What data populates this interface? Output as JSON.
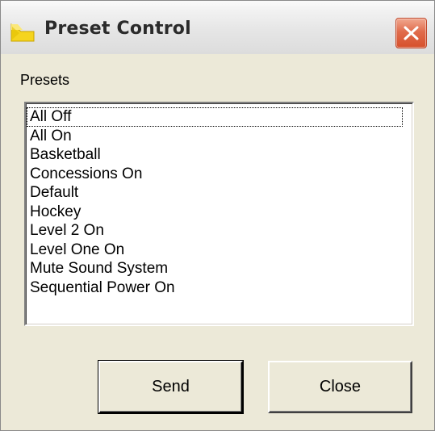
{
  "window": {
    "title": "Preset Control",
    "icon": "folder-arrow-icon",
    "close_icon": "close-x-icon"
  },
  "presets": {
    "label": "Presets",
    "focused_index": 0,
    "items": [
      "All Off",
      "All On",
      "Basketball",
      "Concessions On",
      "Default",
      "Hockey",
      "Level 2 On",
      "Level One On",
      "Mute Sound System",
      "Sequential Power On"
    ]
  },
  "buttons": {
    "send_label": "Send",
    "close_label": "Close"
  },
  "colors": {
    "dialog_face": "#ece9d8",
    "close_button": "#d6502c",
    "icon_yellow": "#f5d41e"
  }
}
